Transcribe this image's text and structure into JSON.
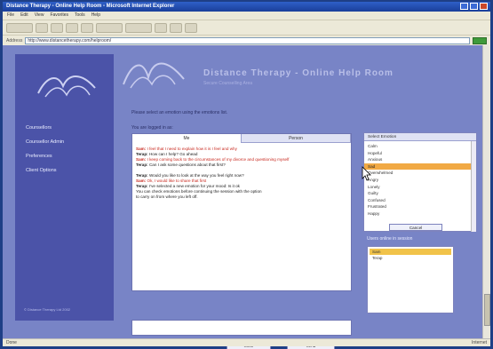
{
  "window": {
    "title": "Distance Therapy - Online Help Room - Microsoft Internet Explorer"
  },
  "menubar": [
    "File",
    "Edit",
    "View",
    "Favorites",
    "Tools",
    "Help"
  ],
  "addressbar": {
    "label": "Address",
    "url": "http://www.distancetherapy.com/helproom/"
  },
  "site": {
    "title": "Distance Therapy - Online Help Room",
    "subtitle": "Secure Counselling Area"
  },
  "sidebar": {
    "nav": [
      {
        "label": "Counsellors"
      },
      {
        "label": "Counsellor Admin"
      },
      {
        "label": "Preferences"
      },
      {
        "label": "Client Options"
      }
    ],
    "footer": "© Distance Therapy Ltd 2002"
  },
  "intro": "Please select an emotion using the emotions list.",
  "logged_in": "You are logged in as:",
  "chat": {
    "tabs": [
      "Me",
      "Person"
    ],
    "messages": [
      {
        "who": "you",
        "speaker": "Sam:",
        "text": " I feel that I need to explain how it is I feel and why"
      },
      {
        "who": "them",
        "speaker": "Terap:",
        "text": " How can I help? Go ahead"
      },
      {
        "who": "you",
        "speaker": "Sam:",
        "text": " I keep coming back to the circumstances of my divorce and questioning myself"
      },
      {
        "who": "them",
        "speaker": "Terap:",
        "text": " Can I ask some questions about that first?"
      },
      {
        "gap": true
      },
      {
        "who": "them",
        "speaker": "Terap:",
        "text": " Would you like to look at the way you feel right now?"
      },
      {
        "who": "you",
        "speaker": "Sam:",
        "text": " Ok, I would like to share that first"
      },
      {
        "who": "them",
        "speaker": "Terap:",
        "text": " I've selected a new emotion for your mood: Is it ok"
      },
      {
        "who": "them",
        "speaker": "",
        "text": "You can check emotions before continuing the session with the option"
      },
      {
        "who": "them",
        "speaker": "",
        "text": "to carry on from where you left off."
      }
    ]
  },
  "buttons": {
    "clear": "Clear",
    "send": "Send"
  },
  "emotions": {
    "header": "Select Emotion",
    "items": [
      "Calm",
      "Hopeful",
      "Anxious",
      "Sad",
      "Overwhelmed",
      "Angry",
      "Lonely",
      "Guilty",
      "Confused",
      "Frustrated",
      "Happy"
    ],
    "selected_index": 3,
    "cancel": "Cancel"
  },
  "users": {
    "label": "Users online in session",
    "items": [
      "Sam",
      "Terap"
    ],
    "selected_index": 0
  },
  "statusbar": {
    "left": "Done",
    "right": "Internet"
  },
  "colors": {
    "page_bg": "#7884c6",
    "sidebar_bg": "#4b53a8",
    "selected": "#f1a944",
    "you_text": "#c8281e"
  }
}
